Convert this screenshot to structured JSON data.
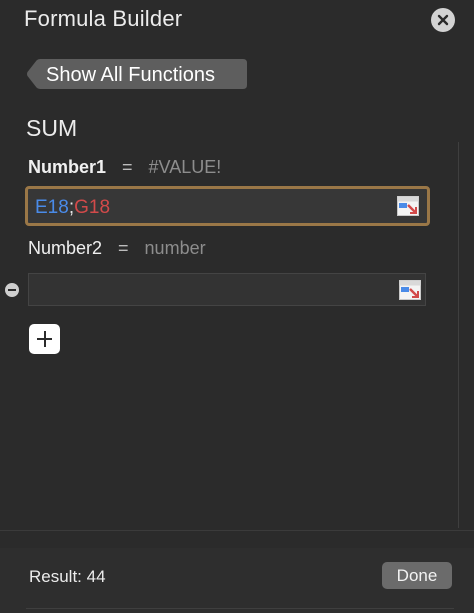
{
  "window": {
    "title": "Formula Builder"
  },
  "nav": {
    "back_label": "Show All Functions"
  },
  "function": {
    "name": "SUM",
    "arguments": [
      {
        "name": "Number1",
        "equals": "=",
        "value": "#VALUE!",
        "input": {
          "ref_a": "E18",
          "separator": ";",
          "ref_b": "G18"
        }
      },
      {
        "name": "Number2",
        "equals": "=",
        "value": "number",
        "input": {
          "value": ""
        }
      }
    ]
  },
  "footer": {
    "result": "Result: 44",
    "done_label": "Done"
  },
  "icons": {
    "close": "close-icon",
    "back": "chevron-left-icon",
    "cell_reference": "cell-reference-icon",
    "remove": "minus-icon",
    "add": "plus-icon"
  },
  "colors": {
    "background": "#2b2b2b",
    "field_focus_border": "#9a7747",
    "ref_a": "#4a8be8",
    "ref_b": "#d24a4a",
    "done_button": "#6b6b6b"
  }
}
